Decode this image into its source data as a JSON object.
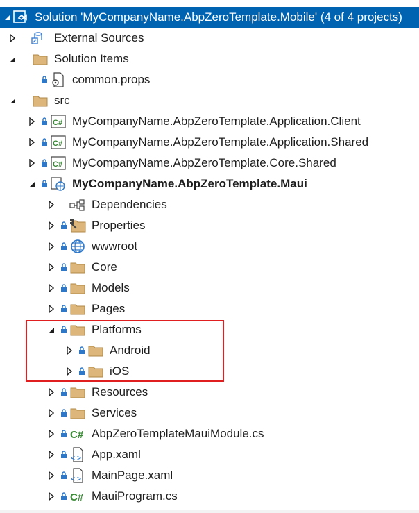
{
  "solution": {
    "label": "Solution 'MyCompanyName.AbpZeroTemplate.Mobile' (4 of 4 projects)"
  },
  "items": [
    {
      "label": "External Sources"
    },
    {
      "label": "Solution Items"
    },
    {
      "label": "common.props"
    },
    {
      "label": "src"
    },
    {
      "label": "MyCompanyName.AbpZeroTemplate.Application.Client"
    },
    {
      "label": "MyCompanyName.AbpZeroTemplate.Application.Shared"
    },
    {
      "label": "MyCompanyName.AbpZeroTemplate.Core.Shared"
    },
    {
      "label": "MyCompanyName.AbpZeroTemplate.Maui"
    },
    {
      "label": "Dependencies"
    },
    {
      "label": "Properties"
    },
    {
      "label": "wwwroot"
    },
    {
      "label": "Core"
    },
    {
      "label": "Models"
    },
    {
      "label": "Pages"
    },
    {
      "label": "Platforms"
    },
    {
      "label": "Android"
    },
    {
      "label": "iOS"
    },
    {
      "label": "Resources"
    },
    {
      "label": "Services"
    },
    {
      "label": "AbpZeroTemplateMauiModule.cs"
    },
    {
      "label": "App.xaml"
    },
    {
      "label": "MainPage.xaml"
    },
    {
      "label": "MauiProgram.cs"
    }
  ],
  "icons": {
    "folder_color": "#dcb67a",
    "csharp_color": "#388a34",
    "selection_color": "#0063b1",
    "highlight_color": "#e02020"
  }
}
